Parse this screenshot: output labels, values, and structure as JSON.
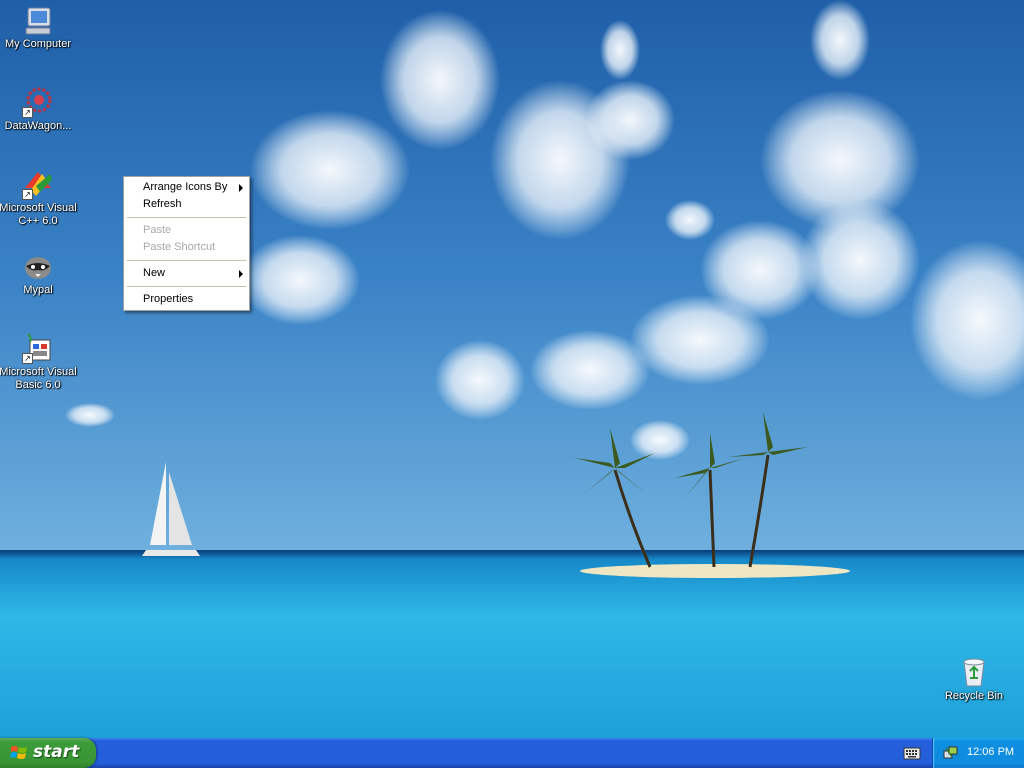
{
  "desktop": {
    "icons": [
      {
        "label": "My Computer",
        "icon": "my-computer-icon"
      },
      {
        "label": "DataWagon...",
        "icon": "datawagon-icon",
        "shortcut": true
      },
      {
        "label": "Microsoft Visual C++ 6.0",
        "icon": "visual-cpp-icon",
        "shortcut": true
      },
      {
        "label": "Mypal",
        "icon": "mypal-raccoon-icon"
      },
      {
        "label": "Microsoft Visual Basic 6.0",
        "icon": "visual-basic-icon",
        "shortcut": true
      },
      {
        "label": "Recycle Bin",
        "icon": "recycle-bin-icon"
      }
    ]
  },
  "context_menu": {
    "arrange_icons_by": "Arrange Icons By",
    "refresh": "Refresh",
    "paste": "Paste",
    "paste_shortcut": "Paste Shortcut",
    "new": "New",
    "properties": "Properties"
  },
  "taskbar": {
    "start_label": "start",
    "clock": "12:06 PM",
    "tray_icons": [
      "keyboard-icon",
      "network-icon"
    ]
  },
  "colors": {
    "taskbar": "#245edb",
    "start_button": "#3c9b3a",
    "tray": "#0f8ce0",
    "sky": "#2a6fb4",
    "sea": "#2eb8e6"
  }
}
